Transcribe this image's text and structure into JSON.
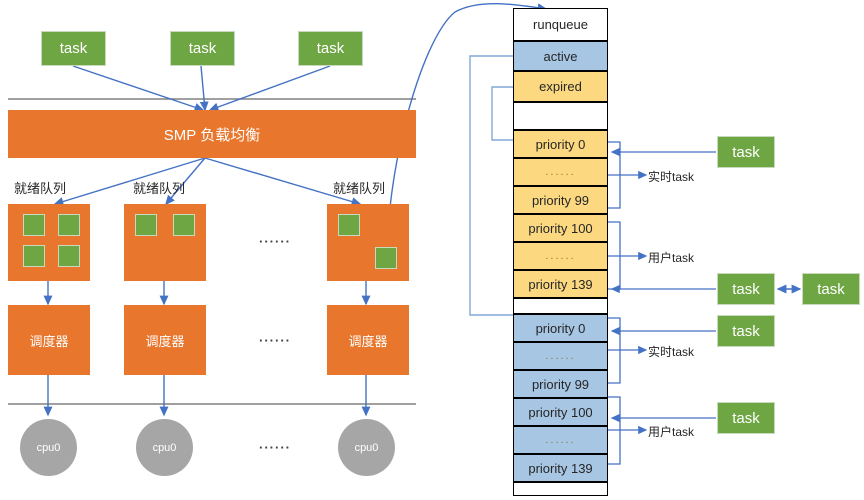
{
  "diagram": {
    "title_hidden": "",
    "colors": {
      "green": "#6FA644",
      "orange": "#E8762C",
      "blue_row": "#A7C6E4",
      "yellow_row": "#FCD980",
      "grey_circle": "#A6A6A6",
      "arrow": "#4472C4",
      "divider": "#808080"
    }
  },
  "top_tasks": [
    {
      "label": "task"
    },
    {
      "label": "task"
    },
    {
      "label": "task"
    }
  ],
  "smp": {
    "label": "SMP 负载均衡"
  },
  "ready_queues": [
    {
      "label": "就绪队列",
      "squares": 4
    },
    {
      "label": "就绪队列",
      "squares": 2
    },
    {
      "label": "就绪队列",
      "squares": 2
    }
  ],
  "schedulers": [
    {
      "label": "调度器"
    },
    {
      "label": "调度器"
    },
    {
      "label": "调度器"
    }
  ],
  "cpus": [
    {
      "label": "cpu0"
    },
    {
      "label": "cpu0"
    },
    {
      "label": "cpu0"
    }
  ],
  "ellipses": {
    "queue_row": "······",
    "scheduler_row": "······",
    "cpu_row": "······"
  },
  "runqueue": {
    "header": "runqueue",
    "active": "active",
    "expired": "expired",
    "spacer_top": "",
    "spacer_mid": "",
    "spacer_bottom": "",
    "expired_priorities": [
      "priority 0",
      "......",
      "priority 99",
      "priority 100",
      "......",
      "priority 139"
    ],
    "active_priorities": [
      "priority 0",
      "......",
      "priority 99",
      "priority 100",
      "......",
      "priority 139"
    ]
  },
  "brace_labels": {
    "expired_realtime": "实时task",
    "expired_user": "用户task",
    "active_realtime": "实时task",
    "active_user": "用户task"
  },
  "right_tasks": [
    {
      "label": "task"
    },
    {
      "label": "task"
    },
    {
      "label": "task"
    },
    {
      "label": "task"
    },
    {
      "label": "task"
    }
  ]
}
